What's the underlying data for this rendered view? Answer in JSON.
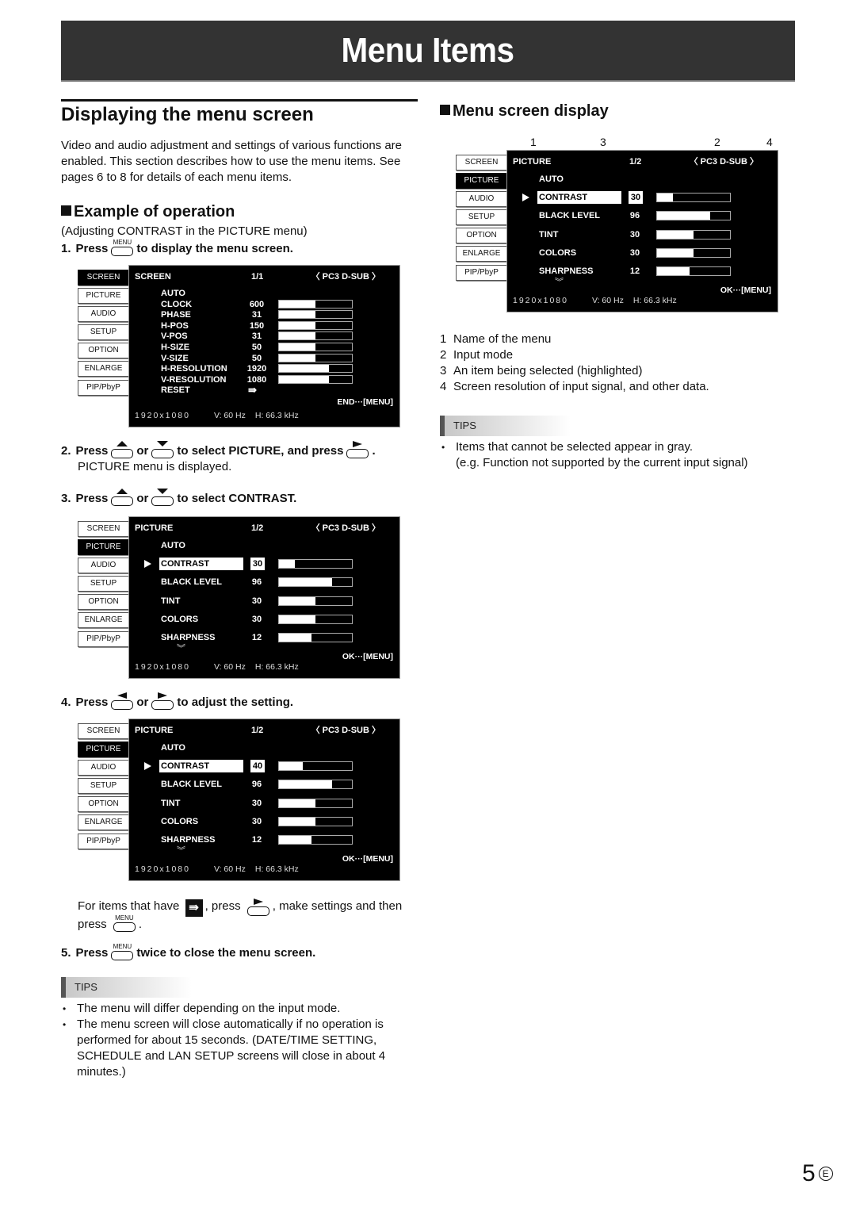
{
  "title": "Menu Items",
  "left": {
    "heading": "Displaying the menu screen",
    "intro": "Video and audio adjustment and settings of various functions are enabled. This section describes how to use the menu items. See pages 6 to 8 for details of each menu items.",
    "example_heading": "Example of operation",
    "example_sub": "(Adjusting CONTRAST in the PICTURE menu)",
    "steps": [
      {
        "num": "1.",
        "pre": "Press",
        "key": "MENU",
        "post": "to display the menu screen."
      },
      {
        "num": "2.",
        "pre": "Press",
        "mid1": "or",
        "post": "to select PICTURE, and press",
        "end": ".",
        "sub": "PICTURE menu is displayed."
      },
      {
        "num": "3.",
        "pre": "Press",
        "mid1": "or",
        "post": "to select CONTRAST."
      },
      {
        "num": "4.",
        "pre": "Press",
        "mid1": "or",
        "post": "to adjust the setting."
      },
      {
        "num": "5.",
        "pre": "Press",
        "key": "MENU",
        "post": "twice to close the menu screen."
      }
    ],
    "note_parts": [
      "For items that have",
      ", press",
      ", make settings and then",
      "press",
      "."
    ],
    "tips_label": "TIPS",
    "tips": [
      "The menu will differ depending on the input mode.",
      "The menu screen will close automatically if no operation is performed for about 15 seconds. (DATE/TIME SETTING, SCHEDULE and LAN SETUP screens will close in about 4 minutes.)"
    ]
  },
  "osd_common": {
    "tabs": [
      "SCREEN",
      "PICTURE",
      "AUDIO",
      "SETUP",
      "OPTION",
      "ENLARGE",
      "PIP/PbyP"
    ],
    "mode": "〈 PC3 D-SUB 〉",
    "resolution": "1920x1080",
    "vfreq": "V: 60 Hz",
    "hfreq": "H: 66.3 kHz",
    "reset_icon": "⇛",
    "chevron_icon": "︾"
  },
  "osd_screen": {
    "name": "SCREEN",
    "page": "1/1",
    "active_tab": 0,
    "footer_action": "END···[MENU]",
    "rows": [
      {
        "label": "AUTO",
        "value": "",
        "level": null
      },
      {
        "label": "CLOCK",
        "value": "600",
        "level": 0.5
      },
      {
        "label": "PHASE",
        "value": "31",
        "level": 0.5
      },
      {
        "label": "H-POS",
        "value": "150",
        "level": 0.5
      },
      {
        "label": "V-POS",
        "value": "31",
        "level": 0.5
      },
      {
        "label": "H-SIZE",
        "value": "50",
        "level": 0.5
      },
      {
        "label": "V-SIZE",
        "value": "50",
        "level": 0.5
      },
      {
        "label": "H-RESOLUTION",
        "value": "1920",
        "level": 0.68
      },
      {
        "label": "V-RESOLUTION",
        "value": "1080",
        "level": 0.68
      },
      {
        "label": "RESET",
        "value": "",
        "level": null,
        "reset": true
      }
    ]
  },
  "osd_picture_a": {
    "name": "PICTURE",
    "page": "1/2",
    "active_tab": 1,
    "footer_action": "OK···[MENU]",
    "rows": [
      {
        "label": "AUTO",
        "value": "",
        "level": null
      },
      {
        "label": "CONTRAST",
        "value": "30",
        "level": 0.22,
        "selected": true
      },
      {
        "label": "BLACK LEVEL",
        "value": "96",
        "level": 0.73
      },
      {
        "label": "TINT",
        "value": "30",
        "level": 0.5
      },
      {
        "label": "COLORS",
        "value": "30",
        "level": 0.5
      },
      {
        "label": "SHARPNESS",
        "value": "12",
        "level": 0.45
      }
    ]
  },
  "osd_picture_b": {
    "name": "PICTURE",
    "page": "1/2",
    "active_tab": 1,
    "footer_action": "OK···[MENU]",
    "rows": [
      {
        "label": "AUTO",
        "value": "",
        "level": null
      },
      {
        "label": "CONTRAST",
        "value": "40",
        "level": 0.33,
        "selected": true
      },
      {
        "label": "BLACK LEVEL",
        "value": "96",
        "level": 0.73
      },
      {
        "label": "TINT",
        "value": "30",
        "level": 0.5
      },
      {
        "label": "COLORS",
        "value": "30",
        "level": 0.5
      },
      {
        "label": "SHARPNESS",
        "value": "12",
        "level": 0.45
      }
    ]
  },
  "right": {
    "heading": "Menu screen display",
    "callout_numbers": [
      "1",
      "3",
      "2",
      "4"
    ],
    "legend": [
      {
        "n": "1",
        "text": "Name of the menu"
      },
      {
        "n": "2",
        "text": "Input mode"
      },
      {
        "n": "3",
        "text": "An item being selected (highlighted)"
      },
      {
        "n": "4",
        "text": "Screen resolution of input signal, and other data."
      }
    ],
    "tips_label": "TIPS",
    "tips": [
      "Items that cannot be selected appear in gray.",
      "(e.g. Function not supported by the current input signal)"
    ]
  },
  "footer": {
    "page": "5",
    "lang": "E"
  }
}
